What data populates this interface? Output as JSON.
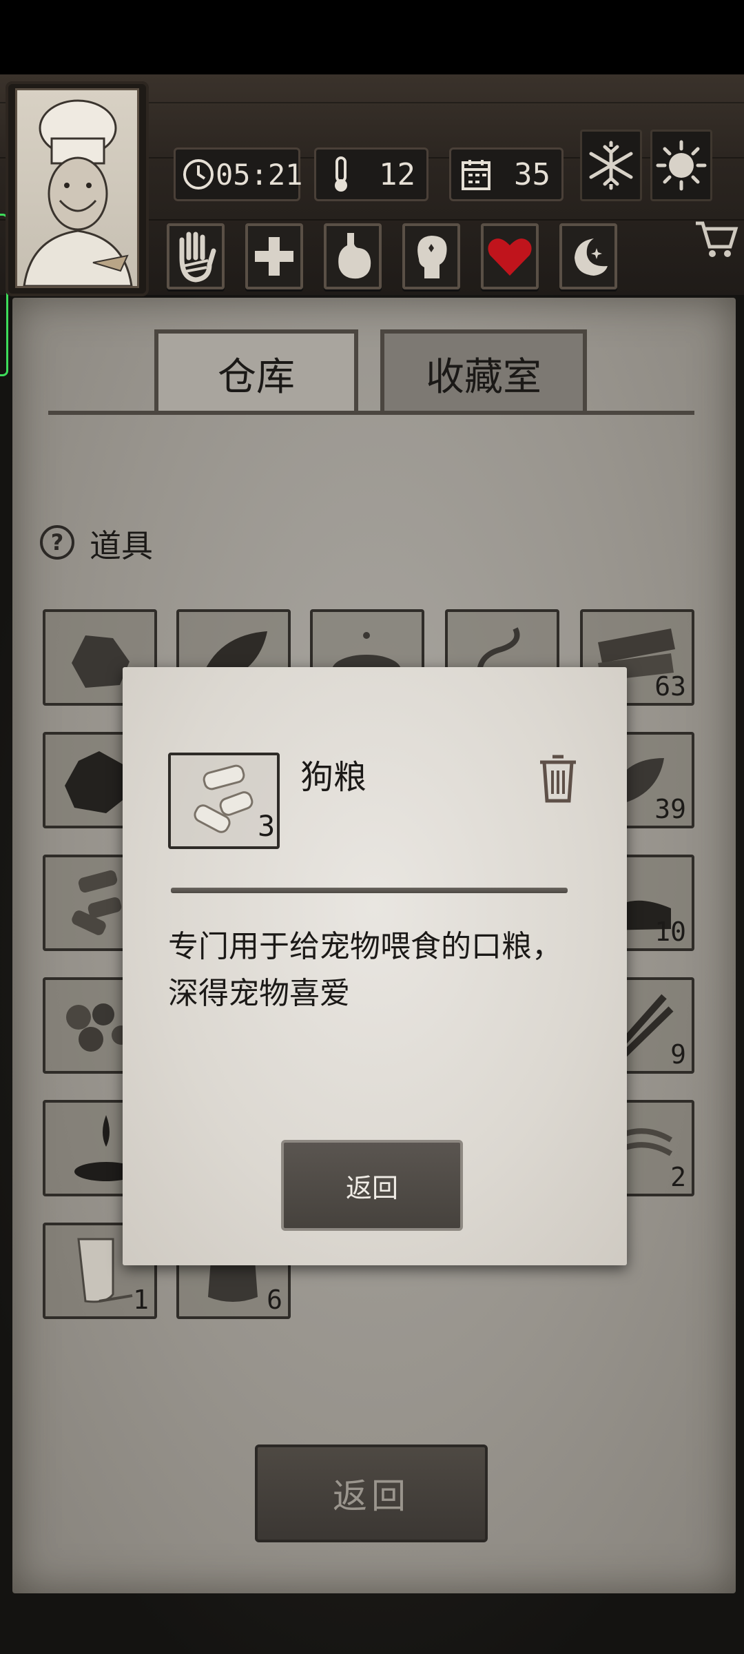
{
  "hud": {
    "time": "05:21",
    "temperature": "12",
    "day": "35"
  },
  "icons": {
    "clock": "clock-icon",
    "thermometer": "thermometer-icon",
    "calendar": "calendar-icon",
    "snowflake": "snowflake-icon",
    "sun": "sun-icon",
    "hand": "bandaged-hand-icon",
    "health": "cross-icon",
    "stomach": "stomach-icon",
    "mind": "head-icon",
    "heart": "heart-icon",
    "sleep": "moon-icon",
    "cart": "cart-icon",
    "trash": "trash-icon"
  },
  "tabs": [
    {
      "label": "仓库"
    },
    {
      "label": "收藏室"
    }
  ],
  "section": {
    "help": "?",
    "title": "道具"
  },
  "grid": {
    "counts": [
      "63",
      "39",
      "10",
      "9",
      "2",
      "1",
      "6"
    ]
  },
  "dialog": {
    "item_name": "狗粮",
    "item_count": "3",
    "description_line1": "专门用于给宠物喂食的口粮，",
    "description_line2": "深得宠物喜爱",
    "return_label": "返回"
  },
  "footer": {
    "return_label": "返回"
  },
  "colors": {
    "heart": "#c0141c",
    "parchment": "#a8a59f",
    "dialog": "#e4e0da",
    "indicator": "#3ddc5a"
  }
}
